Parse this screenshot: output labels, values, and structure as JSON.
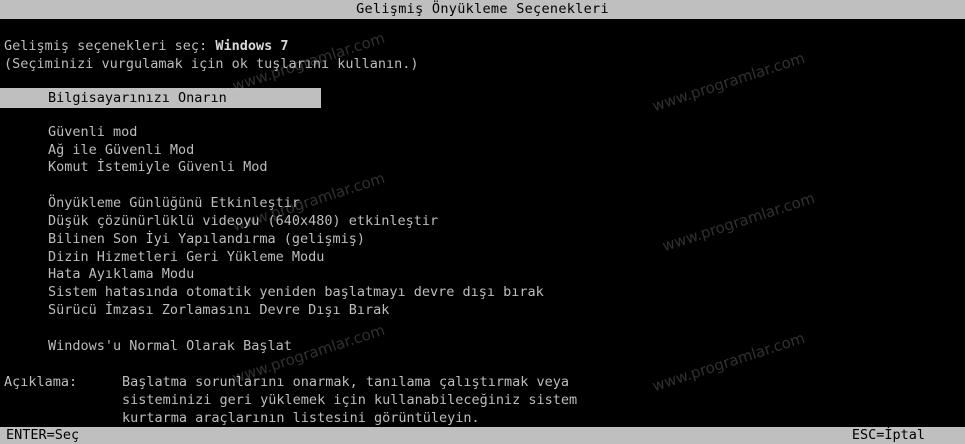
{
  "title": "Gelişmiş Önyükleme Seçenekleri",
  "prompt_prefix": "Gelişmiş seçenekleri seç: ",
  "prompt_os": "Windows 7",
  "instruction": "(Seçiminizi vurgulamak için ok tuşlarını kullanın.)",
  "selected_item": "Bilgisayarınızı Onarın",
  "group1": [
    "Güvenli mod",
    "Ağ ile Güvenli Mod",
    "Komut İstemiyle Güvenli Mod"
  ],
  "group2": [
    "Önyükleme Günlüğünü Etkinleştir",
    "Düşük çözünürlüklü videoyu (640x480) etkinleştir",
    "Bilinen Son İyi Yapılandırma (gelişmiş)",
    "Dizin Hizmetleri Geri Yükleme Modu",
    "Hata Ayıklama Modu",
    "Sistem hatasında otomatik yeniden başlatmayı devre dışı bırak",
    "Sürücü İmzası Zorlamasını Devre Dışı Bırak"
  ],
  "normal_start": "Windows'u Normal Olarak Başlat",
  "description": {
    "label": "Açıklama: ",
    "lines": [
      "Başlatma sorunlarını onarmak, tanılama çalıştırmak veya",
      "sisteminizi geri yüklemek için kullanabileceğiniz sistem",
      "kurtarma araçlarının listesini görüntüleyin."
    ]
  },
  "footer": {
    "left": "ENTER=Seç",
    "right": "ESC=İptal"
  },
  "watermark": "www.programlar.com"
}
